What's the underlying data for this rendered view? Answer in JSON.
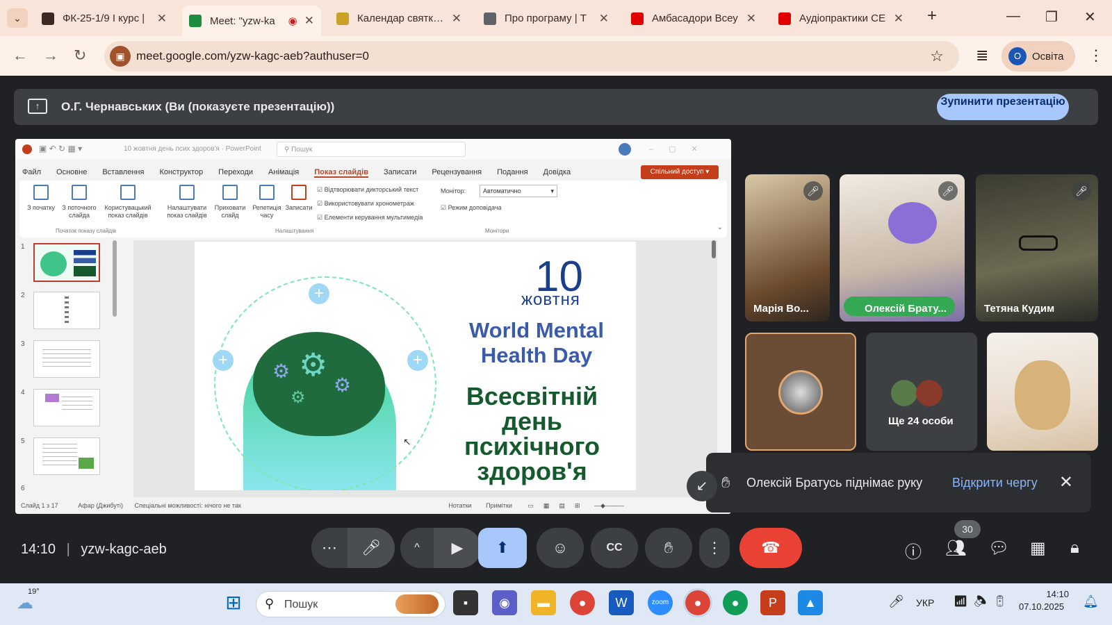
{
  "browser": {
    "tabs": [
      {
        "label": "ФК-25-1/9 І курс |",
        "color": "#3c2a22"
      },
      {
        "label": "Meet: \"yzw-ka",
        "color": "#1e8e3e"
      },
      {
        "label": "Календар святкою",
        "color": "#c9a227"
      },
      {
        "label": "Про програму | Т",
        "color": "#5f6368"
      },
      {
        "label": "Амбасадори Всеу",
        "color": "#e00000"
      },
      {
        "label": "Аудіопрактики СЕ",
        "color": "#e00000"
      }
    ],
    "new_tab": "+",
    "url": "meet.google.com/yzw-kagc-aeb?authuser=0",
    "profile_initial": "О",
    "profile_name": "Освіта"
  },
  "meet": {
    "presenter_text": "О.Г. Чернавських (Ви (показуєте презентацію))",
    "stop_button": "Зупинити презентацію",
    "meeting_time": "14:10",
    "meeting_code": "yzw-kagc-aeb",
    "people_count": "30",
    "participants": [
      {
        "name": "Марія Во...",
        "muted": true
      },
      {
        "name": "Олексій Брату...",
        "muted": true
      },
      {
        "name": "Тетяна Кудим",
        "muted": true
      },
      {
        "name": "",
        "muted": false
      },
      {
        "name": "Ще 24 особи",
        "muted": false
      },
      {
        "name": "",
        "muted": false
      }
    ],
    "toast": {
      "message": "Олексій Братусь піднімає руку",
      "action": "Відкрити чергу"
    }
  },
  "ppt": {
    "doc_title": "10 жовтня день псих здоров'я · PowerPoint",
    "search_placeholder": "Пошук",
    "menu": [
      "Файл",
      "Основне",
      "Вставлення",
      "Конструктор",
      "Переходи",
      "Анімація",
      "Показ слайдів",
      "Записати",
      "Рецензування",
      "Подання",
      "Довідка"
    ],
    "active_menu": "Показ слайдів",
    "share_button": "Спільний доступ",
    "ribbon": {
      "btn_from_start": "З початку",
      "btn_from_current": "З поточного слайда",
      "btn_custom": "Користувацький показ слайдів",
      "btn_setup": "Налаштувати показ слайдів",
      "btn_hide": "Приховати слайд",
      "btn_rehearse": "Репетиція часу",
      "btn_record": "Записати",
      "chk1": "Відтворювати дикторський текст",
      "chk2": "Використовувати хронометраж",
      "chk3": "Елементи керування мультимедіа",
      "monitor_label": "Монітор:",
      "monitor_value": "Автоматично",
      "presenter_view": "Режим доповідача",
      "group1": "Початок показу слайдів",
      "group2": "Налаштування",
      "group3": "Монітори"
    },
    "slide_numbers": [
      "1",
      "2",
      "3",
      "4",
      "5",
      "6"
    ],
    "status": {
      "slide": "Слайд 1 з 17",
      "lang": "Афар (Джибуті)",
      "access": "Спеціальні можливості: нічого не так",
      "notes": "Нотатки",
      "comments": "Примітки"
    },
    "slide": {
      "day": "10",
      "month": "жовтня",
      "en_title": "World Mental Health Day",
      "ua_title": "Всесвітній день психічного здоров'я"
    }
  },
  "taskbar": {
    "weather": "19°",
    "search_placeholder": "Пошук",
    "lang": "УКР",
    "time": "14:10",
    "date": "07.10.2025"
  }
}
